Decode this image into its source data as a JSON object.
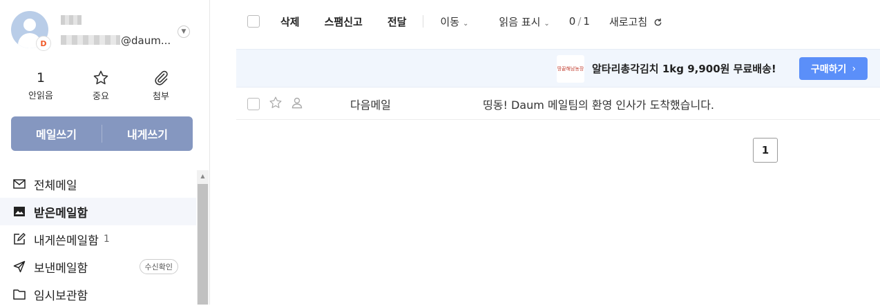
{
  "account": {
    "email_suffix": "@daum...",
    "badge_letter": "D"
  },
  "stats": [
    {
      "value": "1",
      "label": "안읽음"
    },
    {
      "icon": "star-icon",
      "label": "중요"
    },
    {
      "icon": "paperclip-icon",
      "label": "첨부"
    }
  ],
  "compose": {
    "write_label": "메일쓰기",
    "self_label": "내게쓰기"
  },
  "folders": [
    {
      "label": "전체메일",
      "icon": "envelope-icon"
    },
    {
      "label": "받은메일함",
      "icon": "inbox-icon",
      "active": true
    },
    {
      "label": "내게쓴메일함",
      "icon": "note-edit-icon",
      "count": "1"
    },
    {
      "label": "보낸메일함",
      "icon": "paper-plane-icon",
      "badge": "수신확인"
    },
    {
      "label": "임시보관함",
      "icon": "folder-icon"
    }
  ],
  "toolbar": {
    "delete_label": "삭제",
    "spam_label": "스팸신고",
    "forward_label": "전달",
    "move_label": "이동",
    "read_mark_label": "읽음 표시",
    "counter_current": "0",
    "counter_sep": "/",
    "counter_total": "1",
    "refresh_label": "새로고침"
  },
  "ad": {
    "image_text": "땅끝해남농장",
    "text": "알타리총각김치 1kg 9,900원 무료배송!",
    "button_label": "구매하기",
    "button_arrow": "›"
  },
  "messages": [
    {
      "sender": "다음메일",
      "subject": "띵동! Daum 메일팀의 환영 인사가 도착했습니다."
    }
  ],
  "pagination": {
    "current_page": "1"
  },
  "colors": {
    "compose_bg": "#8597c0",
    "ad_button": "#5b8ff9",
    "ad_bg": "#f1f6fd",
    "active_folder_bg": "#f4f6fb"
  }
}
